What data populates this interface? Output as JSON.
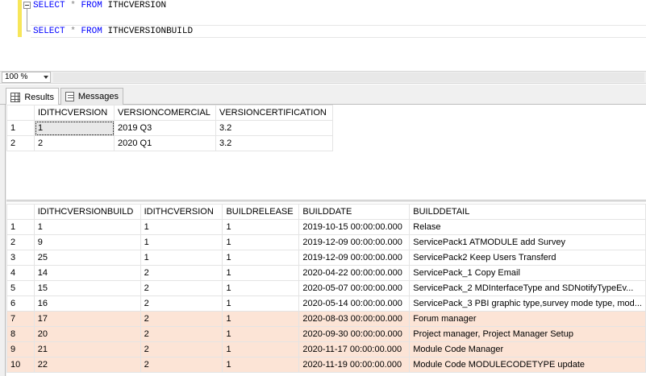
{
  "editor": {
    "line1": {
      "kw1": "SELECT",
      "op": "*",
      "kw2": "FROM",
      "table": "ITHCVERSION"
    },
    "line2": {
      "kw1": "SELECT",
      "op": "*",
      "kw2": "FROM",
      "table": "ITHCVERSIONBUILD"
    }
  },
  "zoom": {
    "value": "100 %"
  },
  "tabs": {
    "results_label": "Results",
    "messages_label": "Messages"
  },
  "grid1": {
    "columns": [
      "IDITHCVERSION",
      "VERSIONCOMERCIAL",
      "VERSIONCERTIFICATION"
    ],
    "rows": [
      {
        "n": "1",
        "c": [
          "1",
          "2019 Q3",
          "3.2"
        ]
      },
      {
        "n": "2",
        "c": [
          "2",
          "2020 Q1",
          "3.2"
        ]
      }
    ]
  },
  "grid2": {
    "columns": [
      "IDITHCVERSIONBUILD",
      "IDITHCVERSION",
      "BUILDRELEASE",
      "BUILDDATE",
      "BUILDDETAIL"
    ],
    "rows": [
      {
        "n": "1",
        "c": [
          "1",
          "1",
          "1",
          "2019-10-15 00:00:00.000",
          "Relase"
        ]
      },
      {
        "n": "2",
        "c": [
          "9",
          "1",
          "1",
          "2019-12-09 00:00:00.000",
          "ServicePack1 ATMODULE add Survey"
        ]
      },
      {
        "n": "3",
        "c": [
          "25",
          "1",
          "1",
          "2019-12-09 00:00:00.000",
          "ServicePack2 Keep Users Transferd"
        ]
      },
      {
        "n": "4",
        "c": [
          "14",
          "2",
          "1",
          "2020-04-22 00:00:00.000",
          "ServicePack_1 Copy Email"
        ]
      },
      {
        "n": "5",
        "c": [
          "15",
          "2",
          "1",
          "2020-05-07 00:00:00.000",
          "ServicePack_2 MDInterfaceType and SDNotifyTypeEv..."
        ]
      },
      {
        "n": "6",
        "c": [
          "16",
          "2",
          "1",
          "2020-05-14 00:00:00.000",
          "ServicePack_3 PBI graphic type,survey mode type, mod..."
        ]
      },
      {
        "n": "7",
        "c": [
          "17",
          "2",
          "1",
          "2020-08-03 00:00:00.000",
          "Forum manager"
        ]
      },
      {
        "n": "8",
        "c": [
          "20",
          "2",
          "1",
          "2020-09-30 00:00:00.000",
          "Project manager, Project Manager Setup"
        ]
      },
      {
        "n": "9",
        "c": [
          "21",
          "2",
          "1",
          "2020-11-17 00:00:00.000",
          "Module Code Manager"
        ]
      },
      {
        "n": "10",
        "c": [
          "22",
          "2",
          "1",
          "2020-11-19 00:00:00.000",
          "Module Code MODULECODETYPE update"
        ]
      }
    ]
  },
  "colors": {
    "keyword": "#0000ff",
    "highlight_row": "#fce4d6",
    "change_bar": "#f7e65a"
  }
}
